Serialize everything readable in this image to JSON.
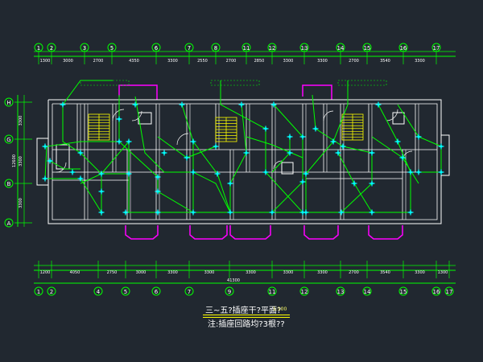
{
  "top_axes": [
    "1",
    "2",
    "3",
    "5",
    "6",
    "7",
    "8",
    "11",
    "12",
    "13",
    "14",
    "15",
    "16",
    "17"
  ],
  "top_dims": [
    "1300",
    "3000",
    "2700",
    "4350",
    "3300",
    "2550",
    "2700",
    "2850",
    "3300",
    "3300",
    "2700",
    "3540",
    "3300",
    "1300"
  ],
  "bottom_axes": [
    "1",
    "2",
    "4",
    "5",
    "6",
    "7",
    "9",
    "11",
    "12",
    "13",
    "14",
    "15",
    "16",
    "17"
  ],
  "bottom_dims": [
    "1200",
    "4050",
    "2750",
    "3000",
    "3300",
    "3300",
    "3300",
    "3300",
    "3300",
    "2700",
    "3540",
    "3300",
    "1300"
  ],
  "total_dim": "41300",
  "row_axes": [
    "H",
    "G",
    "B",
    "A"
  ],
  "left_dims": [
    "3300",
    "3300",
    "3300"
  ],
  "left_total": "12600",
  "title": "三~五?插座干?平面?",
  "scale": "1:100",
  "note": "注:插座回路均?3根??",
  "colors": {
    "wall": "#ffffff",
    "wire": "#00ff00",
    "device": "#00ffff",
    "balcony": "#ff00ff",
    "dim": "#00ff00",
    "stair": "#ffff00",
    "bg": "#212830"
  }
}
